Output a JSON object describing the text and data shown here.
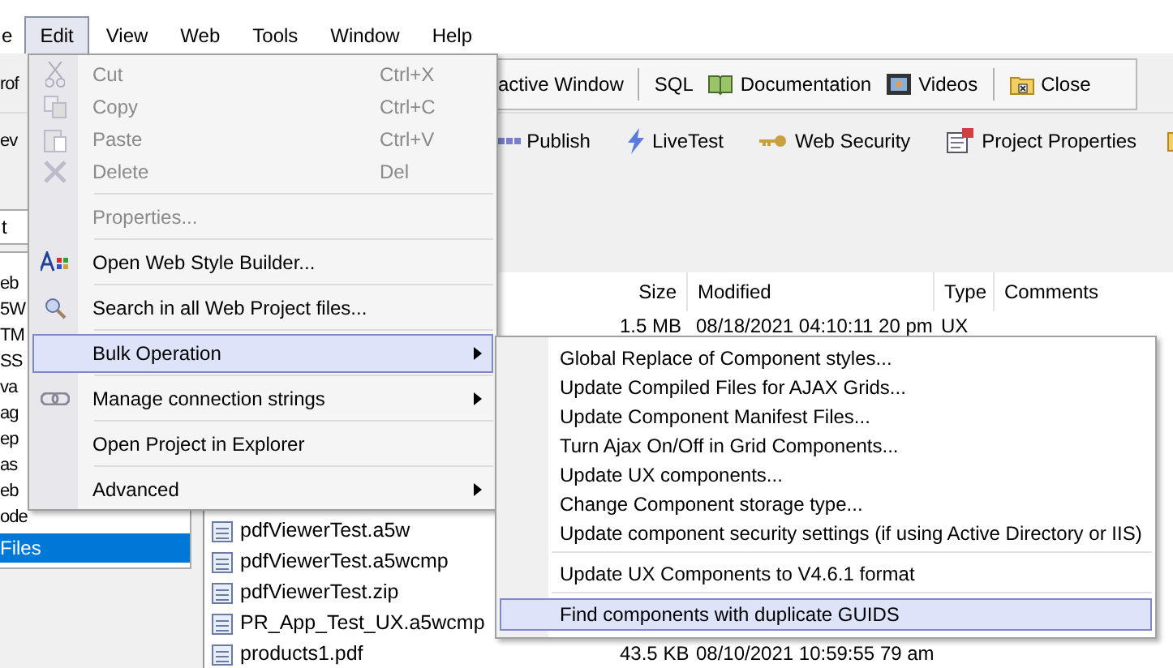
{
  "menubar": [
    {
      "label": "e",
      "selected": false
    },
    {
      "label": "Edit",
      "selected": true
    },
    {
      "label": "View",
      "selected": false
    },
    {
      "label": "Web",
      "selected": false
    },
    {
      "label": "Tools",
      "selected": false
    },
    {
      "label": "Window",
      "selected": false
    },
    {
      "label": "Help",
      "selected": false
    }
  ],
  "toolbar_1": {
    "cut_left": "rof",
    "items": [
      {
        "label": "active Window",
        "divider_after": true
      },
      {
        "label": "SQL",
        "divider_after": false
      },
      {
        "label": "Documentation",
        "divider_after": false
      },
      {
        "label": "Videos",
        "divider_after": true
      },
      {
        "label": "Close",
        "divider_after": false
      }
    ]
  },
  "toolbar_2": {
    "cut_left": "ev",
    "items": [
      {
        "label": "Publish"
      },
      {
        "label": "LiveTest"
      },
      {
        "label": "Web Security"
      },
      {
        "label": "Project Properties"
      }
    ]
  },
  "left_panel": {
    "field_value": "t",
    "items": [
      {
        "label": "eb",
        "selected": false
      },
      {
        "label": "5W",
        "selected": false
      },
      {
        "label": "TM",
        "selected": false
      },
      {
        "label": "SS",
        "selected": false
      },
      {
        "label": "va",
        "selected": false
      },
      {
        "label": "ag",
        "selected": false
      },
      {
        "label": "ep",
        "selected": false
      },
      {
        "label": "as",
        "selected": false
      },
      {
        "label": "eb",
        "selected": false
      },
      {
        "label": "ode",
        "selected": false
      },
      {
        "label": "Files",
        "selected": true
      }
    ]
  },
  "file_list": {
    "columns": [
      "Size",
      "Modified",
      "Type",
      "Comments"
    ],
    "rows": [
      {
        "size": "1.5 MB",
        "modified": "08/18/2021 04:10:11 20 pm",
        "type": "UX"
      },
      {
        "name": "pdfViewerTest.a5w"
      },
      {
        "name": "pdfViewerTest.a5wcmp"
      },
      {
        "name": "pdfViewerTest.zip"
      },
      {
        "name": "PR_App_Test_UX.a5wcmp"
      },
      {
        "name": "products1.pdf",
        "size": "43.5 KB",
        "modified": "08/10/2021 10:59:55 79 am"
      }
    ]
  },
  "edit_menu": [
    {
      "label": "Cut",
      "shortcut": "Ctrl+X",
      "disabled": true,
      "selected": false,
      "submenu": false,
      "divider_after": false
    },
    {
      "label": "Copy",
      "shortcut": "Ctrl+C",
      "disabled": true,
      "selected": false,
      "submenu": false,
      "divider_after": false
    },
    {
      "label": "Paste",
      "shortcut": "Ctrl+V",
      "disabled": true,
      "selected": false,
      "submenu": false,
      "divider_after": false
    },
    {
      "label": "Delete",
      "shortcut": "Del",
      "disabled": true,
      "selected": false,
      "submenu": false,
      "divider_after": true
    },
    {
      "label": "Properties...",
      "disabled": true,
      "selected": false,
      "submenu": false,
      "divider_after": true
    },
    {
      "label": "Open Web Style Builder...",
      "disabled": false,
      "selected": false,
      "submenu": false,
      "divider_after": true
    },
    {
      "label": "Search in all Web Project files...",
      "disabled": false,
      "selected": false,
      "submenu": false,
      "divider_after": true
    },
    {
      "label": "Bulk Operation",
      "disabled": false,
      "selected": true,
      "submenu": true,
      "divider_after": true
    },
    {
      "label": "Manage connection strings",
      "disabled": false,
      "selected": false,
      "submenu": true,
      "divider_after": true
    },
    {
      "label": "Open Project in Explorer",
      "disabled": false,
      "selected": false,
      "submenu": false,
      "divider_after": true
    },
    {
      "label": "Advanced",
      "disabled": false,
      "selected": false,
      "submenu": true,
      "divider_after": false
    }
  ],
  "bulk_submenu": [
    {
      "label": "Global Replace of Component styles...",
      "selected": false,
      "divider_after": false
    },
    {
      "label": "Update Compiled Files for AJAX Grids...",
      "selected": false,
      "divider_after": false
    },
    {
      "label": "Update Component Manifest Files...",
      "selected": false,
      "divider_after": false
    },
    {
      "label": "Turn Ajax On/Off in Grid Components...",
      "selected": false,
      "divider_after": false
    },
    {
      "label": "Update UX components...",
      "selected": false,
      "divider_after": false
    },
    {
      "label": "Change Component storage type...",
      "selected": false,
      "divider_after": false
    },
    {
      "label": "Update component security settings (if using Active Directory or IIS)",
      "selected": false,
      "divider_after": true
    },
    {
      "label": "Update UX Components to V4.6.1 format",
      "selected": false,
      "divider_after": true
    },
    {
      "label": "Find components with duplicate GUIDS",
      "selected": true,
      "divider_after": false
    }
  ]
}
